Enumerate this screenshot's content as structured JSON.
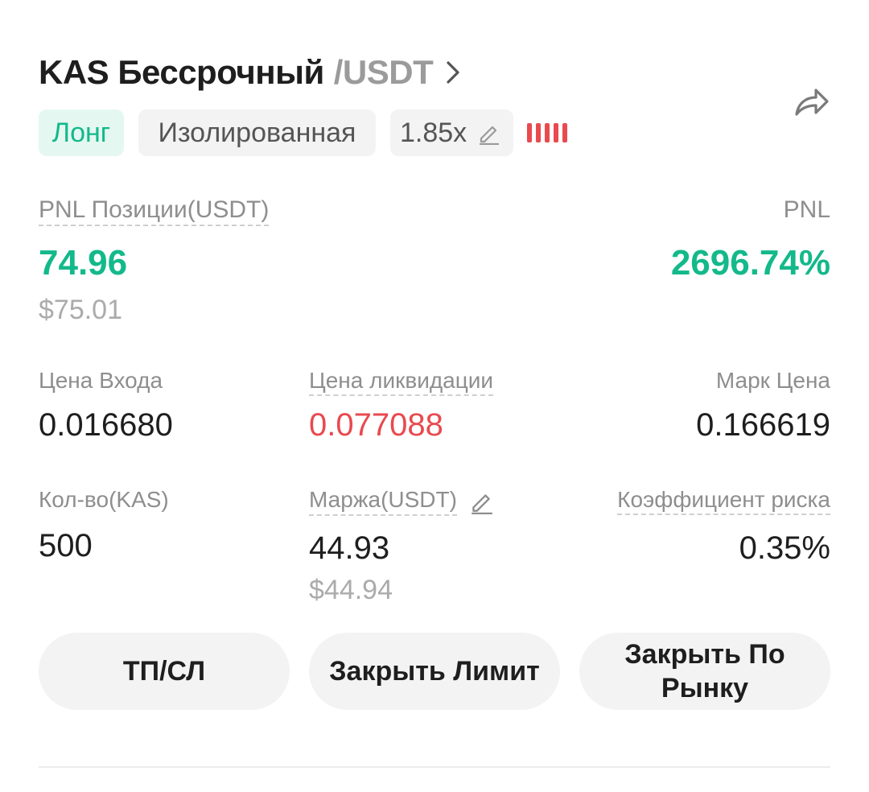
{
  "header": {
    "symbol": "KAS Бессрочный",
    "quote": "/USDT",
    "chevron_icon": "chevron-right-icon",
    "share_icon": "share-icon"
  },
  "tags": {
    "side": "Лонг",
    "margin_mode": "Изолированная",
    "leverage": "1.85x",
    "edit_icon": "pencil-icon",
    "risk_level_bars": 5
  },
  "pnl": {
    "position_label": "PNL Позиции(USDT)",
    "position_value": "74.96",
    "position_usd": "$75.01",
    "roi_label": "PNL",
    "roi_value": "2696.74%"
  },
  "stats": {
    "entry_label": "Цена Входа",
    "entry_value": "0.016680",
    "liq_label": "Цена ликвидации",
    "liq_value": "0.077088",
    "mark_label": "Марк Цена",
    "mark_value": "0.166619",
    "qty_label": "Кол-во(KAS)",
    "qty_value": "500",
    "margin_label": "Маржа(USDT)",
    "margin_value": "44.93",
    "margin_usd": "$44.94",
    "risk_label": "Коэффициент риска",
    "risk_value": "0.35%"
  },
  "buttons": {
    "tpsl": "ТП/СЛ",
    "close_limit": "Закрыть Лимит",
    "close_market": "Закрыть По Рынку"
  },
  "colors": {
    "green": "#13b98a",
    "red": "#e84a4f",
    "long_bg": "#e5f7f1",
    "chip_bg": "#f3f3f3"
  }
}
